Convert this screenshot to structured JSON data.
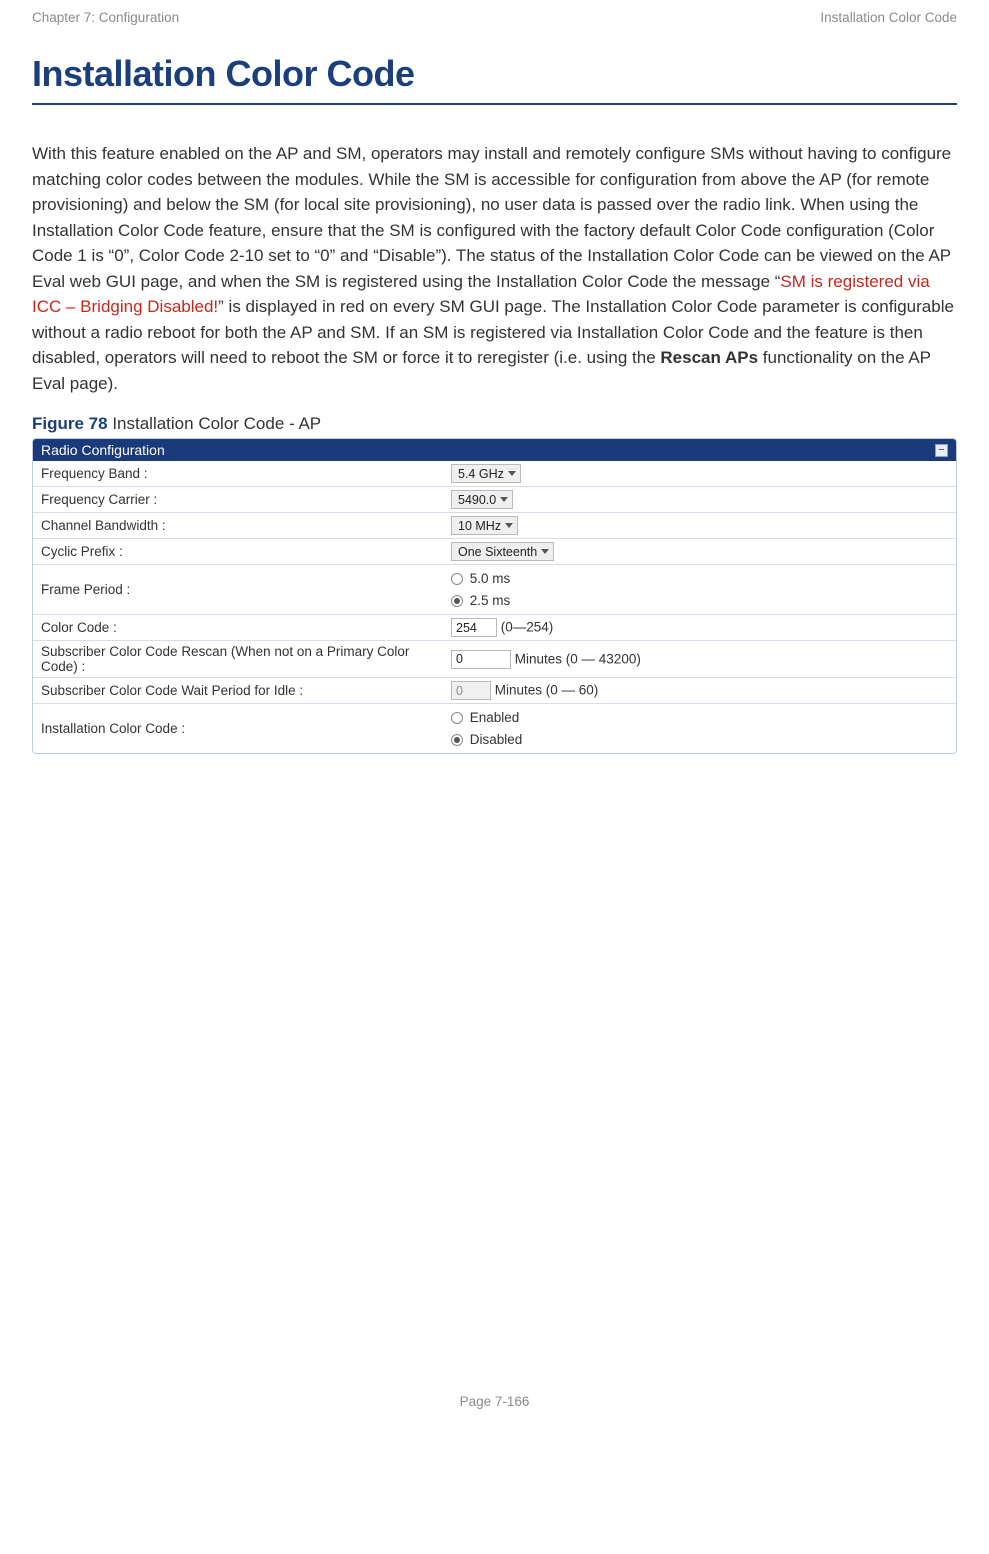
{
  "header": {
    "left": "Chapter 7:  Configuration",
    "right": "Installation Color Code"
  },
  "title": "Installation Color Code",
  "paragraph": {
    "p1a": "With this feature enabled on the AP and SM, operators may install and remotely configure SMs without having to configure matching color codes between the modules. While the SM is accessible for configuration from above the AP (for remote provisioning) and below the SM (for local site provisioning), no user data is passed over the radio link. When using the Installation Color Code feature, ensure that the SM is configured with the factory default Color Code configuration (Color Code 1 is “0”, Color Code 2-10 set to “0” and “Disable”). The status of the Installation Color Code can be viewed on the AP Eval web GUI page, and when the SM is registered using the Installation Color Code the message “",
    "red": "SM is registered via ICC – Bridging Disabled!",
    "p1b": "” is displayed in red on every SM GUI page. The Installation Color Code parameter is configurable without a radio reboot for both the AP and SM. If an SM is registered via Installation Color Code and the feature is then disabled, operators will need to reboot the SM or force it to reregister (i.e. using the ",
    "bold": "Rescan APs",
    "p1c": " functionality on the AP Eval page)."
  },
  "figure": {
    "label": "Figure 78",
    "caption": "  Installation Color Code - AP"
  },
  "panel": {
    "title": "Radio Configuration",
    "rows": {
      "freq_band": {
        "label": "Frequency Band :",
        "value": "5.4 GHz"
      },
      "freq_carrier": {
        "label": "Frequency Carrier :",
        "value": "5490.0"
      },
      "chan_bw": {
        "label": "Channel Bandwidth :",
        "value": "10 MHz"
      },
      "cyclic": {
        "label": "Cyclic Prefix :",
        "value": "One Sixteenth"
      },
      "frame": {
        "label": "Frame Period :",
        "opt1": "5.0 ms",
        "opt2": "2.5 ms"
      },
      "colorcode": {
        "label": "Color Code :",
        "value": "254",
        "hint": "(0—254)"
      },
      "rescan": {
        "label": "Subscriber Color Code Rescan (When not on a Primary Color Code) :",
        "value": "0",
        "hint": "Minutes (0 — 43200)"
      },
      "wait": {
        "label": "Subscriber Color Code Wait Period for Idle :",
        "value": "0",
        "hint": "Minutes (0 — 60)"
      },
      "icc": {
        "label": "Installation Color Code :",
        "opt1": "Enabled",
        "opt2": "Disabled"
      }
    }
  },
  "footer": "Page 7-166"
}
